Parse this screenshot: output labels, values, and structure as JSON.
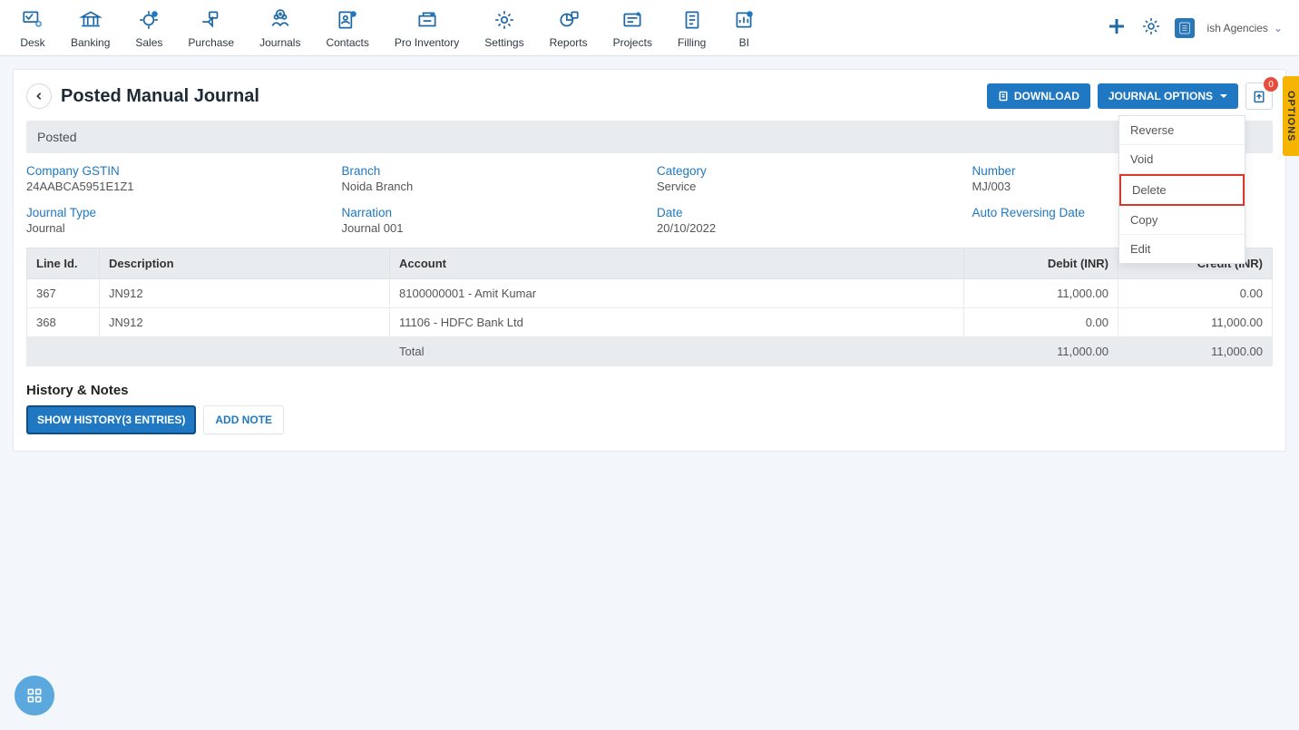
{
  "nav": {
    "items": [
      {
        "label": "Desk"
      },
      {
        "label": "Banking"
      },
      {
        "label": "Sales"
      },
      {
        "label": "Purchase"
      },
      {
        "label": "Journals"
      },
      {
        "label": "Contacts"
      },
      {
        "label": "Pro Inventory"
      },
      {
        "label": "Settings"
      },
      {
        "label": "Reports"
      },
      {
        "label": "Projects"
      },
      {
        "label": "Filling"
      },
      {
        "label": "BI"
      }
    ],
    "company": "ish Agencies"
  },
  "header": {
    "title": "Posted Manual Journal",
    "download": "DOWNLOAD",
    "options": "JOURNAL OPTIONS",
    "uploadCount": "0"
  },
  "dropdown": {
    "items": [
      {
        "label": "Reverse"
      },
      {
        "label": "Void"
      },
      {
        "label": "Delete",
        "highlighted": true
      },
      {
        "label": "Copy"
      },
      {
        "label": "Edit"
      }
    ]
  },
  "status": "Posted",
  "fields": {
    "gstinLabel": "Company GSTIN",
    "gstin": "24AABCA5951E1Z1",
    "branchLabel": "Branch",
    "branch": "Noida Branch",
    "categoryLabel": "Category",
    "category": "Service",
    "numberLabel": "Number",
    "number": "MJ/003",
    "jtypeLabel": "Journal Type",
    "jtype": "Journal",
    "narrationLabel": "Narration",
    "narration": "Journal 001",
    "dateLabel": "Date",
    "date": "20/10/2022",
    "autoRevLabel": "Auto Reversing Date",
    "autoRev": ""
  },
  "table": {
    "headers": {
      "lineId": "Line Id.",
      "desc": "Description",
      "account": "Account",
      "debit": "Debit (INR)",
      "credit": "Credit (INR)"
    },
    "rows": [
      {
        "lineId": "367",
        "desc": "JN912",
        "account": "8100000001 - Amit Kumar",
        "debit": "11,000.00",
        "credit": "0.00"
      },
      {
        "lineId": "368",
        "desc": "JN912",
        "account": "11106 - HDFC Bank Ltd",
        "debit": "0.00",
        "credit": "11,000.00"
      }
    ],
    "totalLabel": "Total",
    "totalDebit": "11,000.00",
    "totalCredit": "11,000.00"
  },
  "history": {
    "title": "History & Notes",
    "showBtn": "SHOW HISTORY(3 ENTRIES)",
    "addNote": "ADD NOTE"
  },
  "optionsTab": "OPTIONS"
}
